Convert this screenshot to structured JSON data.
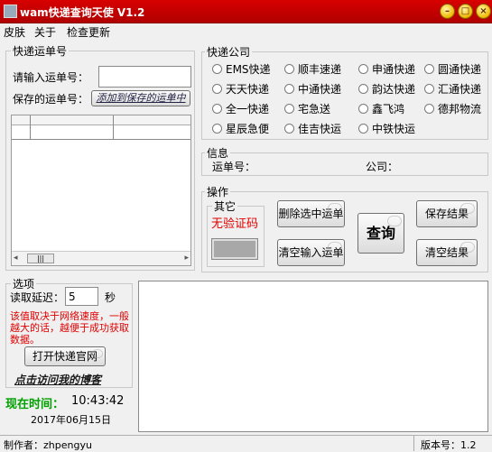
{
  "window": {
    "title": "wam快递查询天使 V1.2",
    "min": "–",
    "max": "□",
    "close": "×"
  },
  "menu": [
    "皮肤",
    "关于",
    "检查更新"
  ],
  "tracking": {
    "group_title": "快递运单号",
    "input_label": "请输入运单号：",
    "input_value": "",
    "saved_label": "保存的运单号：",
    "saved_select_placeholder": "添加到保存的运单中"
  },
  "companies": {
    "group_title": "快递公司",
    "items": [
      "EMS快递",
      "顺丰速递",
      "申通快递",
      "圆通快递",
      "天天快递",
      "中通快递",
      "韵达快递",
      "汇通快递",
      "全一快递",
      "宅急送",
      "鑫飞鸿",
      "德邦物流",
      "星辰急便",
      "佳吉快运",
      "中铁快运"
    ]
  },
  "info": {
    "group_title": "信息",
    "tracking_no_label": "运单号：",
    "company_label": "公司："
  },
  "actions": {
    "group_title": "操作",
    "other_title": "其它",
    "no_captcha": "无验证码",
    "delete_selected": "删除选中运单",
    "clear_input": "清空输入运单",
    "query": "查询",
    "save_result": "保存结果",
    "clear_result": "清空结果"
  },
  "options": {
    "group_title": "选项",
    "delay_label": "读取延迟：",
    "delay_value": "5",
    "delay_unit": "秒",
    "note": "该值取决于网络速度，一般越大的话，越便于成功获取数据。",
    "open_official": "打开快递官网",
    "blog_link": "点击访问我的博客"
  },
  "clock": {
    "label": "现在时间：",
    "time": "10:43:42",
    "date": "2017年06月15日"
  },
  "status": {
    "author": "制作者：zhpengyu",
    "version": "版本号：1.2"
  },
  "colors": {
    "title_bg": "#c80000",
    "red_text": "#e00000",
    "green_text": "#00a000"
  }
}
